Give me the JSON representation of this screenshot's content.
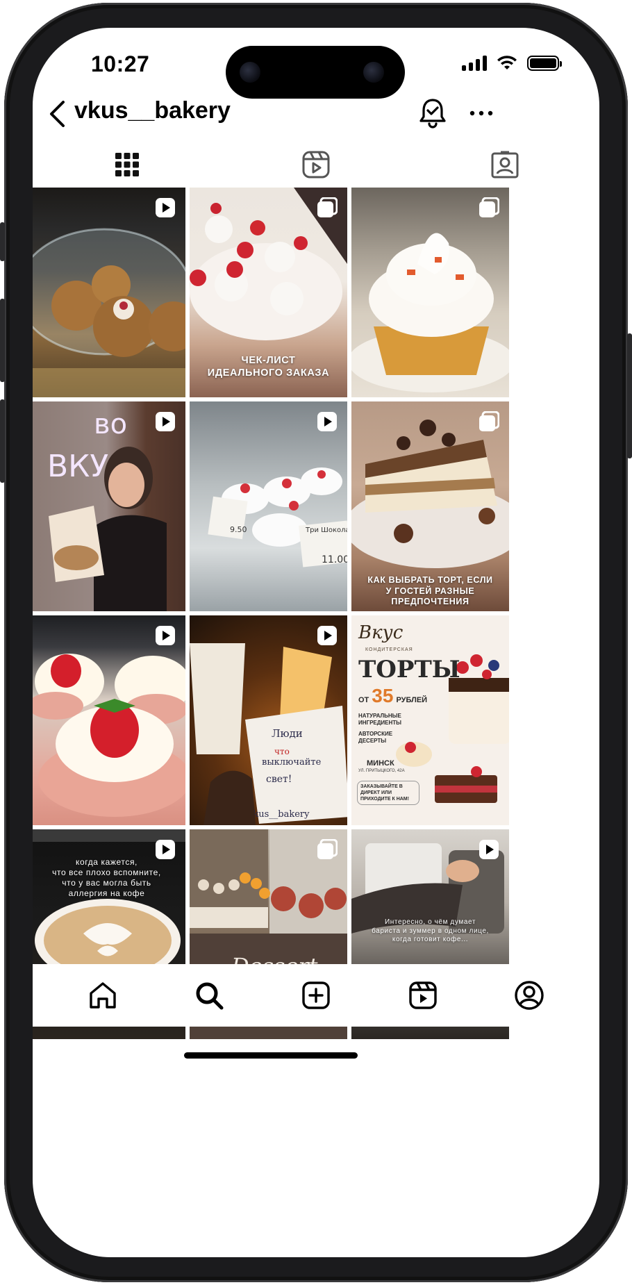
{
  "status": {
    "time": "10:27"
  },
  "header": {
    "username": "vkus__bakery"
  },
  "tabs": [
    {
      "name": "posts-grid"
    },
    {
      "name": "reels"
    },
    {
      "name": "tagged"
    }
  ],
  "grid": {
    "tiles": [
      {
        "subject": "cookies under glass dome",
        "badge": "reel-icon",
        "caption": []
      },
      {
        "subject": "strawberry coconut cake",
        "badge": "carousel-icon",
        "caption": [
          "ЧЕК-ЛИСТ",
          "ИДЕАЛЬНОГО ЗАКАЗА"
        ]
      },
      {
        "subject": "meringue tartlet",
        "badge": "carousel-icon",
        "caption": []
      },
      {
        "subject": "girl with pastry box",
        "badge": "reel-icon",
        "caption": [],
        "neon_lines": [
          "во",
          "ВКУ"
        ]
      },
      {
        "subject": "pavlova display case",
        "badge": "reel-icon",
        "caption": [],
        "price_tags": [
          "9.50",
          "Три Шоколад",
          "11.00"
        ]
      },
      {
        "subject": "cheesecake slice",
        "badge": "carousel-icon",
        "caption": [
          "КАК ВЫБРАТЬ ТОРТ, ЕСЛИ",
          "У ГОСТЕЙ РАЗНЫЕ ПРЕДПОЧТЕНИЯ"
        ]
      },
      {
        "subject": "strawberry pavlovas",
        "badge": "reel-icon",
        "caption": []
      },
      {
        "subject": "coffee cups",
        "badge": "reel-icon",
        "caption": [],
        "cup_text": [
          "Люди",
          "что",
          "выключайте",
          "свет!",
          "vkus__bakery"
        ]
      },
      {
        "subject": "cakes promo",
        "badge": "",
        "promo": {
          "brand": "Вкус",
          "brand_sub": "КОНДИТЕРСКАЯ",
          "headline": "ТОРТЫ",
          "from": "ОТ",
          "price": "35",
          "currency": "РУБЛЕЙ",
          "features": [
            "НАТУРАЛЬНЫЕ ИНГРЕДИЕНТЫ",
            "АВТОРСКИЕ ДЕСЕРТЫ"
          ],
          "city": "МИНСК",
          "address": "УЛ. ПРИТЫЦКОГО, 42А",
          "cta": "ЗАКАЗЫВАЙТЕ В ДИРЕКТ ИЛИ ПРИХОДИТЕ К НАМ!"
        },
        "caption": []
      },
      {
        "subject": "latte art",
        "badge": "reel-icon",
        "caption": [
          "когда кажется,",
          "что все плохо вспомните,",
          "что у вас могла быть",
          "аллергия на кофе"
        ]
      },
      {
        "subject": "dessert showcase",
        "badge": "carousel-icon",
        "caption": [],
        "script_text": "Dessert"
      },
      {
        "subject": "barista at coffee machine",
        "badge": "reel-icon",
        "caption": [
          "Интересно, о чём думает",
          "бариста и зуммер в одном лице,",
          "когда готовит кофе..."
        ]
      }
    ]
  },
  "bottom_nav": [
    {
      "name": "home-icon"
    },
    {
      "name": "search-icon"
    },
    {
      "name": "create-icon"
    },
    {
      "name": "reels-icon"
    },
    {
      "name": "profile-icon"
    }
  ],
  "colors": {
    "text": "#000000",
    "background": "#ffffff",
    "accent_orange": "#e07a2a"
  }
}
